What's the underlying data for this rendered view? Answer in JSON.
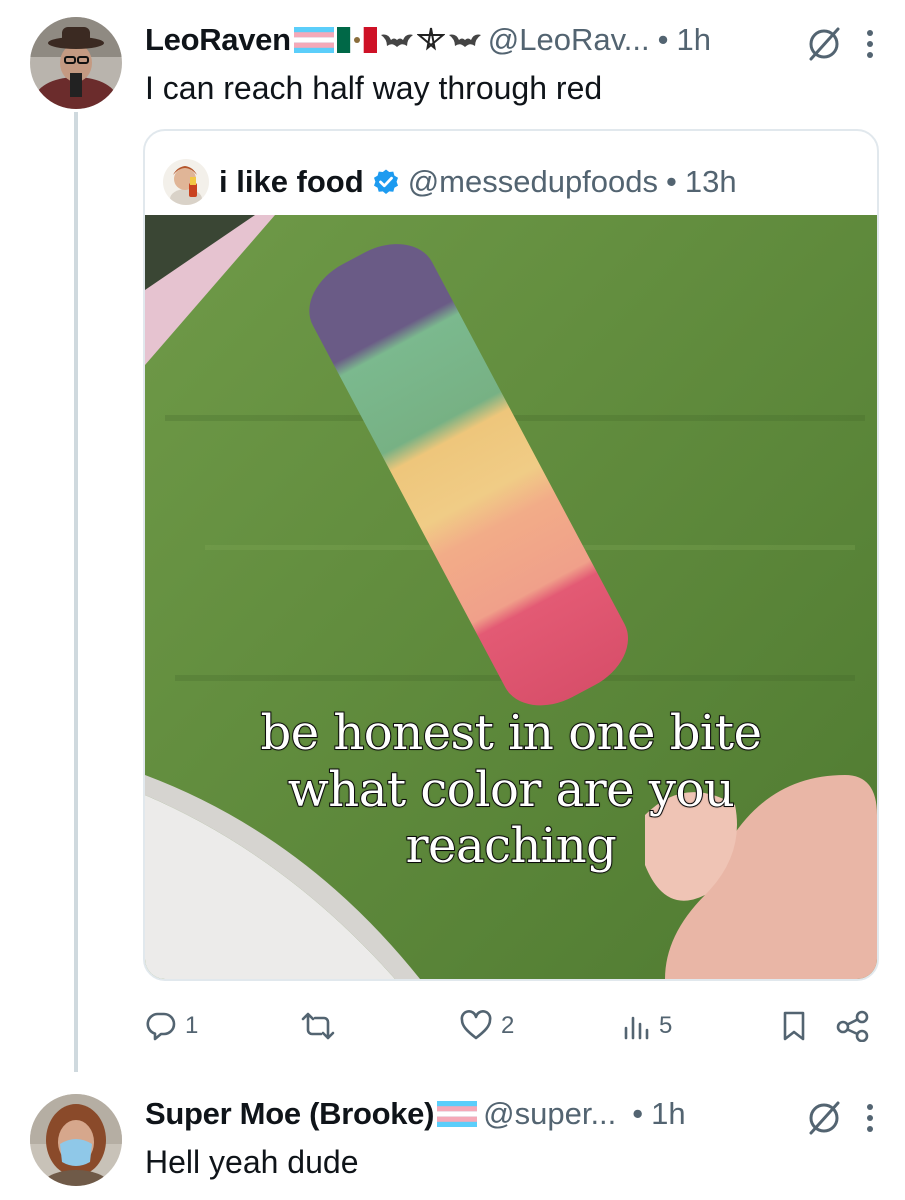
{
  "post1": {
    "author_name": "LeoRaven",
    "handle": "@LeoRav...",
    "separator": "•",
    "time": "1h",
    "text": "I can reach half way through red",
    "quote": {
      "author_name": "i like food",
      "handle": "@messedupfoods",
      "separator": "•",
      "time": "13h",
      "caption_lines": [
        "be honest in one bite",
        "what color are you",
        "reaching"
      ]
    },
    "actions": {
      "replies": "1",
      "retweets": "",
      "likes": "2",
      "views": "5"
    }
  },
  "post2": {
    "author_name": "Super Moe (Brooke)",
    "handle": "@super...",
    "separator": "•",
    "time": "1h",
    "text": "Hell yeah dude"
  },
  "colors": {
    "secondary_text": "#536471",
    "thread_line": "#cfd9de",
    "verified_blue": "#1d9bf0"
  }
}
